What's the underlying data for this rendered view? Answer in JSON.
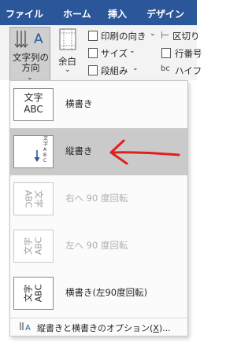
{
  "tabs": [
    "ファイル",
    "ホーム",
    "挿入",
    "デザイン"
  ],
  "ribbon": {
    "text_direction_label_1": "文字列の",
    "text_direction_label_2": "方向",
    "margins_label": "余白",
    "print_orientation": "印刷の向き",
    "size": "サイズ",
    "columns": "段組み",
    "breaks": "区切り",
    "line_numbers": "行番号",
    "hyphenation": "ハイフ",
    "hyphen_icon_text": "bc"
  },
  "menu": {
    "items": [
      {
        "label": "横書き",
        "state": "enabled"
      },
      {
        "label": "縦書き",
        "state": "selected"
      },
      {
        "label": "右へ 90 度回転",
        "state": "disabled"
      },
      {
        "label": "左へ 90 度回転",
        "state": "disabled"
      },
      {
        "label": "横書き(左90度回転)",
        "state": "enabled"
      }
    ],
    "icon_text_line1": "文字",
    "icon_text_line2": "ABC",
    "options_label_prefix": "縦書きと横書きのオプション(",
    "options_label_key": "X",
    "options_label_suffix": ")..."
  },
  "colors": {
    "ribbon_tab_bar": "#2b579a",
    "selected_item": "#cacaca",
    "annotation_arrow": "#e02020"
  }
}
